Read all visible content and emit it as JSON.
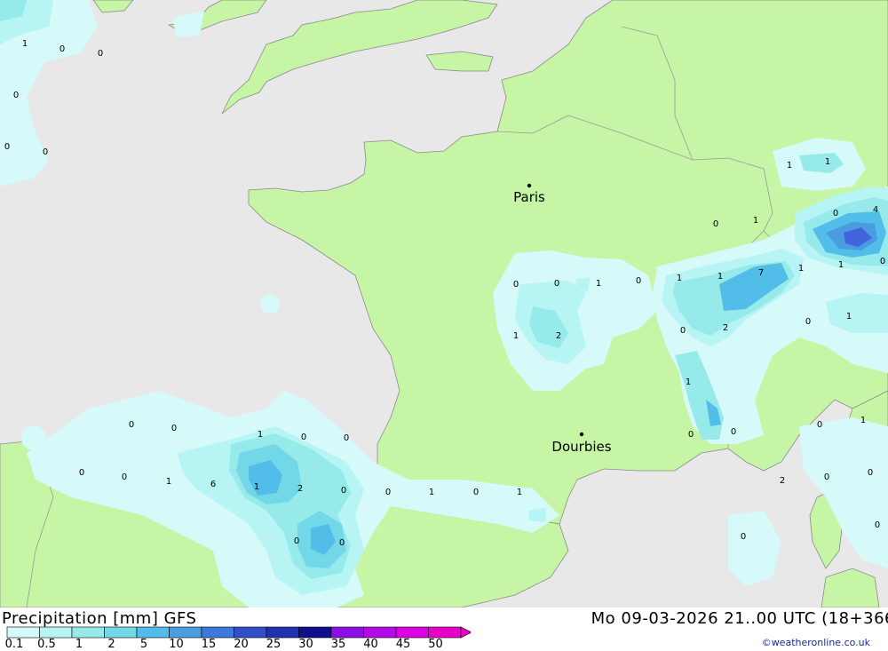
{
  "footer": {
    "title": "Precipitation [mm] GFS",
    "datetime": "Mo 09-03-2026 21..00 UTC (18+366",
    "credit": "©weatheronline.co.uk"
  },
  "legend": {
    "ticks": [
      "0.1",
      "0.5",
      "1",
      "2",
      "5",
      "10",
      "15",
      "20",
      "25",
      "30",
      "35",
      "40",
      "45",
      "50"
    ],
    "colors": [
      "#d6f9f9",
      "#b7f4f4",
      "#96eaea",
      "#72d8e8",
      "#52bde8",
      "#4a9be0",
      "#3f78dc",
      "#3050c8",
      "#2030b0",
      "#10108c",
      "#8c10e6",
      "#b40ae6",
      "#dc00e6",
      "#e600c8"
    ]
  },
  "colors": {
    "sea": "#e8e8e8",
    "land": "#c5f5a5",
    "border": "#a0a0a0",
    "precip_light": "#d6f9f9",
    "precip_mid": "#96eaea",
    "precip_heavy": "#52bde8",
    "precip_max": "#3f64dc"
  },
  "cities": [
    {
      "name": "Paris"
    },
    {
      "name": "Dourbies"
    }
  ],
  "labels": [
    "1",
    "0",
    "0",
    "0",
    "0",
    "0",
    "1",
    "1",
    "0",
    "4",
    "0",
    "1",
    "0",
    "0",
    "0",
    "1",
    "0",
    "1",
    "1",
    "7",
    "1",
    "1",
    "1",
    "2",
    "0",
    "0",
    "2",
    "1",
    "1",
    "0",
    "1",
    "0",
    "0",
    "1",
    "0",
    "0",
    "0",
    "0",
    "0",
    "0",
    "1",
    "6",
    "1",
    "2",
    "0",
    "0",
    "1",
    "0",
    "1",
    "2",
    "0",
    "0",
    "0",
    "0",
    "0",
    "0"
  ]
}
